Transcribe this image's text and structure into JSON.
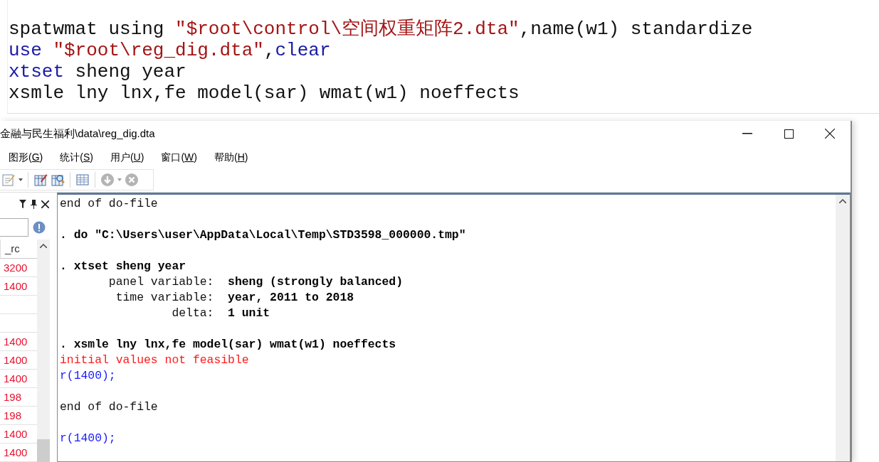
{
  "editor": {
    "lines": [
      [
        {
          "kind": "plain",
          "text": "spatwmat using "
        },
        {
          "kind": "string",
          "text": "\"$root\\control\\空间权重矩阵2.dta\""
        },
        {
          "kind": "plain",
          "text": ",name(w1) standardize"
        }
      ],
      [
        {
          "kind": "keyword",
          "text": "use"
        },
        {
          "kind": "string",
          "text": " \"$root\\reg_dig.dta\""
        },
        {
          "kind": "plain",
          "text": ","
        },
        {
          "kind": "keyword",
          "text": "clear"
        }
      ],
      [
        {
          "kind": "keyword",
          "text": "xtset"
        },
        {
          "kind": "plain",
          "text": " sheng year"
        }
      ],
      [
        {
          "kind": "plain",
          "text": "xsmle lny lnx,fe model(sar) wmat(w1) noeffects"
        }
      ]
    ]
  },
  "window": {
    "title": "金融与民生福利\\data\\reg_dig.dta"
  },
  "menu": [
    {
      "before": "图形(",
      "key": "G",
      "after": ")"
    },
    {
      "before": "统计(",
      "key": "S",
      "after": ")"
    },
    {
      "before": "用户(",
      "key": "U",
      "after": ")"
    },
    {
      "before": "窗口(",
      "key": "W",
      "after": ")"
    },
    {
      "before": "帮助(",
      "key": "H",
      "after": ")"
    }
  ],
  "toolbar": [
    {
      "kind": "note",
      "disabled": false
    },
    {
      "kind": "caret",
      "disabled": false
    },
    {
      "kind": "sep"
    },
    {
      "kind": "editor",
      "disabled": false
    },
    {
      "kind": "browser",
      "disabled": false
    },
    {
      "kind": "sep"
    },
    {
      "kind": "grid",
      "disabled": false
    },
    {
      "kind": "sep"
    },
    {
      "kind": "more",
      "disabled": true
    },
    {
      "kind": "caret",
      "disabled": true
    },
    {
      "kind": "break",
      "disabled": true
    }
  ],
  "variables": {
    "column": "_rc",
    "rows": [
      "3200",
      "1400",
      "",
      "",
      "1400",
      "1400",
      "1400",
      "198",
      "198",
      "1400",
      "1400"
    ]
  },
  "results": [
    {
      "kind": "text",
      "segments": [
        {
          "kind": "plain",
          "text": "end of do-file"
        }
      ]
    },
    {
      "kind": "blank"
    },
    {
      "kind": "text",
      "segments": [
        {
          "kind": "command",
          "text": ". do \"C:\\Users\\user\\AppData\\Local\\Temp\\STD3598_000000.tmp\""
        }
      ]
    },
    {
      "kind": "blank"
    },
    {
      "kind": "text",
      "segments": [
        {
          "kind": "command",
          "text": ". xtset sheng year"
        }
      ]
    },
    {
      "kind": "text",
      "segments": [
        {
          "kind": "plain",
          "text": "       panel variable:  "
        },
        {
          "kind": "command",
          "text": "sheng (strongly balanced)"
        }
      ]
    },
    {
      "kind": "text",
      "segments": [
        {
          "kind": "plain",
          "text": "        time variable:  "
        },
        {
          "kind": "command",
          "text": "year, 2011 to 2018"
        }
      ]
    },
    {
      "kind": "text",
      "segments": [
        {
          "kind": "plain",
          "text": "                delta:  "
        },
        {
          "kind": "command",
          "text": "1 unit"
        }
      ]
    },
    {
      "kind": "blank"
    },
    {
      "kind": "text",
      "segments": [
        {
          "kind": "command",
          "text": ". xsmle lny lnx,fe model(sar) wmat(w1) noeffects"
        }
      ]
    },
    {
      "kind": "text",
      "segments": [
        {
          "kind": "error",
          "text": "initial values not feasible"
        }
      ]
    },
    {
      "kind": "text",
      "segments": [
        {
          "kind": "link",
          "text": "r(1400);"
        }
      ]
    },
    {
      "kind": "blank"
    },
    {
      "kind": "text",
      "segments": [
        {
          "kind": "plain",
          "text": "end of do-file"
        }
      ]
    },
    {
      "kind": "blank"
    },
    {
      "kind": "text",
      "segments": [
        {
          "kind": "link",
          "text": "r(1400);"
        }
      ]
    }
  ]
}
